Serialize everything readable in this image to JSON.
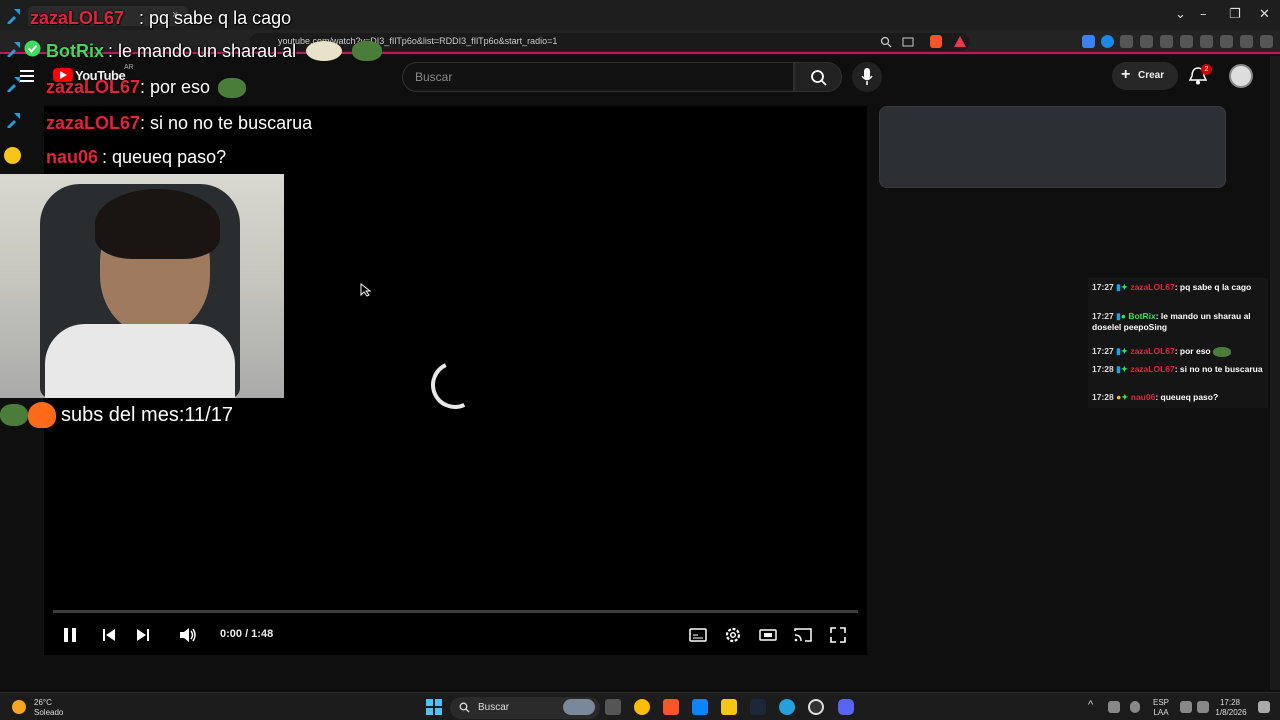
{
  "browser": {
    "url": "youtube.com/watch?v=DI3_fIlTp6o&list=RDDI3_fIlTp6o&start_radio=1",
    "tab_close": "×",
    "window_controls": [
      "⌄",
      "–",
      "❐",
      "✕"
    ]
  },
  "youtube": {
    "logo_text": "YouTube",
    "country_code": "AR",
    "search_placeholder": "Buscar",
    "create_label": "Crear",
    "notification_count": "2"
  },
  "player": {
    "time": "0:00 / 1:48",
    "progress": 0
  },
  "chat_overlay": [
    {
      "user": "zazaLOL67",
      "message": ": pq sabe q la cago",
      "user_color": "red"
    },
    {
      "user": "BotRix",
      "message": ": le mando un sharau al",
      "user_color": "green"
    },
    {
      "user": "zazaLOL67",
      "message": ": por eso",
      "user_color": "red"
    },
    {
      "user": "zazaLOL67",
      "message": ": si no no te buscarua",
      "user_color": "red"
    },
    {
      "user": "nau06",
      "message": ": queueq paso?",
      "user_color": "red"
    }
  ],
  "subs_text": "subs del mes:11/17",
  "chat_log": [
    {
      "time": "17:27",
      "user": "zazaLOL67",
      "message": ": pq sabe q la cago",
      "user_color": "red"
    },
    {
      "time": "17:27",
      "user": "BotRix",
      "message": ": le mando un sharau al doselel peepoSing",
      "user_color": "green"
    },
    {
      "time": "17:27",
      "user": "zazaLOL67",
      "message": ": por eso",
      "user_color": "red"
    },
    {
      "time": "17:28",
      "user": "zazaLOL67",
      "message": ": si no no te buscarua",
      "user_color": "red"
    },
    {
      "time": "17:28",
      "user": "nau06",
      "message": ": queueq paso?",
      "user_color": "red"
    }
  ],
  "taskbar": {
    "weather_temp": "26°C",
    "weather_desc": "Soleado",
    "search_label": "Buscar",
    "lang_top": "ESP",
    "lang_bottom": "LAA",
    "clock_time": "17:28",
    "clock_date": "1/8/2026"
  },
  "colors": {
    "accent": "#c2185b",
    "user_red": "#e0243a",
    "user_green": "#3ddc5a"
  }
}
